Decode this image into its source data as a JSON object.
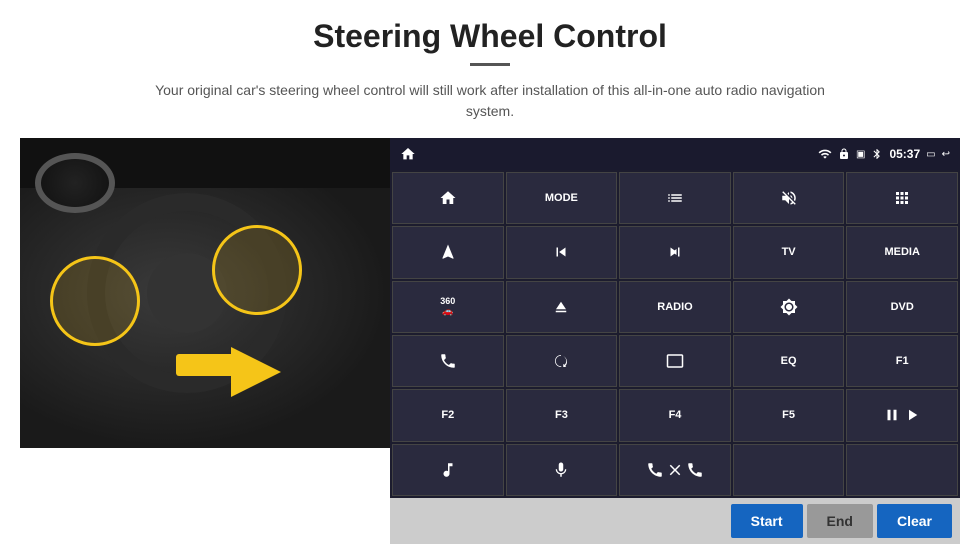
{
  "header": {
    "title": "Steering Wheel Control",
    "subtitle": "Your original car's steering wheel control will still work after installation of this all-in-one auto radio navigation system."
  },
  "status_bar": {
    "time": "05:37",
    "icons": [
      "wifi",
      "lock",
      "sim",
      "bluetooth",
      "battery",
      "window",
      "back"
    ]
  },
  "grid_buttons": [
    {
      "id": "home",
      "label": "",
      "icon": "home"
    },
    {
      "id": "mode",
      "label": "MODE",
      "icon": ""
    },
    {
      "id": "list",
      "label": "",
      "icon": "list"
    },
    {
      "id": "mute",
      "label": "",
      "icon": "mute"
    },
    {
      "id": "apps",
      "label": "",
      "icon": "apps"
    },
    {
      "id": "nav",
      "label": "",
      "icon": "nav"
    },
    {
      "id": "prev",
      "label": "",
      "icon": "prev"
    },
    {
      "id": "next",
      "label": "",
      "icon": "next"
    },
    {
      "id": "tv",
      "label": "TV",
      "icon": ""
    },
    {
      "id": "media",
      "label": "MEDIA",
      "icon": ""
    },
    {
      "id": "cam360",
      "label": "",
      "icon": "360"
    },
    {
      "id": "eject",
      "label": "",
      "icon": "eject"
    },
    {
      "id": "radio",
      "label": "RADIO",
      "icon": ""
    },
    {
      "id": "brightness",
      "label": "",
      "icon": "brightness"
    },
    {
      "id": "dvd",
      "label": "DVD",
      "icon": ""
    },
    {
      "id": "phone",
      "label": "",
      "icon": "phone"
    },
    {
      "id": "swirl",
      "label": "",
      "icon": "swirl"
    },
    {
      "id": "screen",
      "label": "",
      "icon": "screen"
    },
    {
      "id": "eq",
      "label": "EQ",
      "icon": ""
    },
    {
      "id": "f1",
      "label": "F1",
      "icon": ""
    },
    {
      "id": "f2",
      "label": "F2",
      "icon": ""
    },
    {
      "id": "f3",
      "label": "F3",
      "icon": ""
    },
    {
      "id": "f4",
      "label": "F4",
      "icon": ""
    },
    {
      "id": "f5",
      "label": "F5",
      "icon": ""
    },
    {
      "id": "playpause",
      "label": "",
      "icon": "playpause"
    },
    {
      "id": "music",
      "label": "",
      "icon": "music"
    },
    {
      "id": "mic",
      "label": "",
      "icon": "mic"
    },
    {
      "id": "call",
      "label": "",
      "icon": "call"
    },
    {
      "id": "empty1",
      "label": "",
      "icon": ""
    },
    {
      "id": "empty2",
      "label": "",
      "icon": ""
    }
  ],
  "bottom_bar": {
    "start_label": "Start",
    "end_label": "End",
    "clear_label": "Clear"
  }
}
